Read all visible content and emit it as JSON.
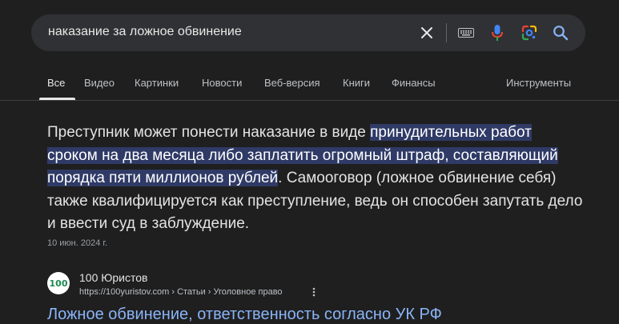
{
  "search": {
    "query": "наказание за ложное обвинение"
  },
  "tabs": [
    {
      "label": "Все",
      "active": true
    },
    {
      "label": "Видео"
    },
    {
      "label": "Картинки"
    },
    {
      "label": "Новости"
    },
    {
      "label": "Веб-версия"
    },
    {
      "label": "Книги"
    },
    {
      "label": "Финансы"
    }
  ],
  "tools_label": "Инструменты",
  "snippet": {
    "before": "Преступник может понести наказание в виде ",
    "highlight": "принудительных работ сроком на два месяца либо заплатить огромный штраф, составляющий порядка пяти миллионов рублей",
    "after": ". Самооговор (ложное обвинение себя) также квалифицируется как преступление, ведь он способен запутать дело и ввести суд в заблуждение.",
    "date": "10 июн. 2024 г."
  },
  "result": {
    "site_name": "100 Юристов",
    "url": "https://100yuristov.com › Статьи › Уголовное право",
    "favicon_text": "100",
    "title": "Ложное обвинение, ответственность согласно УК РФ"
  },
  "icons": {
    "clear": "close-icon",
    "keyboard": "keyboard-icon",
    "voice": "microphone-icon",
    "lens": "lens-icon",
    "search": "search-icon",
    "more": "more-vertical-icon"
  },
  "colors": {
    "background": "#1f1f1f",
    "highlight": "#2f3a66",
    "link": "#8ab4f8",
    "accent_green": "#1a8a50"
  }
}
